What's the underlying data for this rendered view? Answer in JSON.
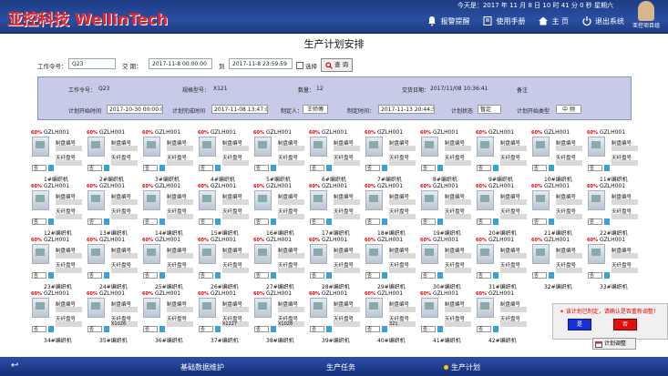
{
  "header": {
    "brand": "亚控科技 WellinTech",
    "datetime": "今天是：2017 年 11 月 8 日 10 时 41 分 0 秒 星期六",
    "nav": [
      {
        "label": "报警提醒",
        "icon": "bell-icon"
      },
      {
        "label": "使用手册",
        "icon": "manual-icon"
      },
      {
        "label": "主 页",
        "icon": "home-icon"
      },
      {
        "label": "退出系统",
        "icon": "power-icon"
      }
    ],
    "user": "亚控项目组"
  },
  "page_title": "生产计划安排",
  "filter": {
    "order_label": "工作令号：",
    "order_value": "Q23",
    "delivery_label": "交 期：",
    "from_value": "2017-11-8 00:00:00",
    "to_label": "到",
    "to_value": "2017-11-8 23:59:59",
    "select_label": "选择",
    "query_label": "查 询"
  },
  "panel": {
    "order_label": "工作令号：",
    "order_value": "Q23",
    "spec_label": "规格型号：",
    "spec_value": "X121",
    "qty_label": "数量：",
    "qty_value": "12",
    "delivery_label": "交货日期：",
    "delivery_value": "2017/11/08 10:36:41",
    "note_label": "备注",
    "plan_start_label": "计划开始时间",
    "plan_start_value": "2017-10-30 00:00:00",
    "plan_end_label": "计划完成时间",
    "plan_end_value": "2017-11-08 13:47:00",
    "owner_label": "制定人：",
    "owner_value": "王师傅",
    "make_time_label": "制定时间：",
    "make_time_value": "2017-11-13 20:44:50",
    "state_label": "计划状态",
    "state_value": "暂定",
    "plan_type_label": "计划开始类型",
    "plan_type_value": "中 频"
  },
  "machines": {
    "code": "GZLH001",
    "label1": "制盘编号",
    "label2": "天纤盘号",
    "select": "否",
    "rows": [
      {
        "pct": "60%",
        "names": [
          "1#编织机",
          "2#编织机",
          "3#编织机",
          "4#编织机",
          "5#编织机",
          "6#编织机",
          "7#编织机",
          "8#编织机",
          "9#编织机",
          "10#编织机",
          "11#编织机"
        ]
      },
      {
        "pct": "60%",
        "names": [
          "12#编织机",
          "13#编织机",
          "14#编织机",
          "15#编织机",
          "16#编织机",
          "17#编织机",
          "18#编织机",
          "19#编织机",
          "20#编织机",
          "21#编织机",
          "22#编织机"
        ]
      },
      {
        "pct": "60%",
        "names": [
          "23#编织机",
          "24#编织机",
          "25#编织机",
          "26#编织机",
          "27#编织机",
          "28#编织机",
          "29#编织机",
          "30#编织机",
          "31#编织机",
          "32#编织机",
          "33#编织机"
        ]
      },
      {
        "pct": "60%",
        "names": [
          "34#编织机",
          "35#编织机",
          "36#编织机",
          "37#编织机",
          "38#编织机",
          "39#编织机",
          "40#编织机",
          "41#编织机",
          "42#编织机"
        ]
      }
    ],
    "row4_values": [
      "",
      "X1026",
      "",
      "X1227",
      "X1028",
      "",
      "321",
      "",
      ""
    ]
  },
  "dialog": {
    "message": "✶ 该计划已制定，请确认是否重新调整！",
    "yes": "是",
    "no": "否"
  },
  "schedule_button": "计划调整",
  "footer": {
    "back": "↩",
    "items": [
      "基础数据维护",
      "生产任务",
      "生产计划"
    ]
  },
  "colors": {
    "accent": "#1d3c84",
    "alert": "#e00000",
    "panel": "#c7cbe8"
  }
}
